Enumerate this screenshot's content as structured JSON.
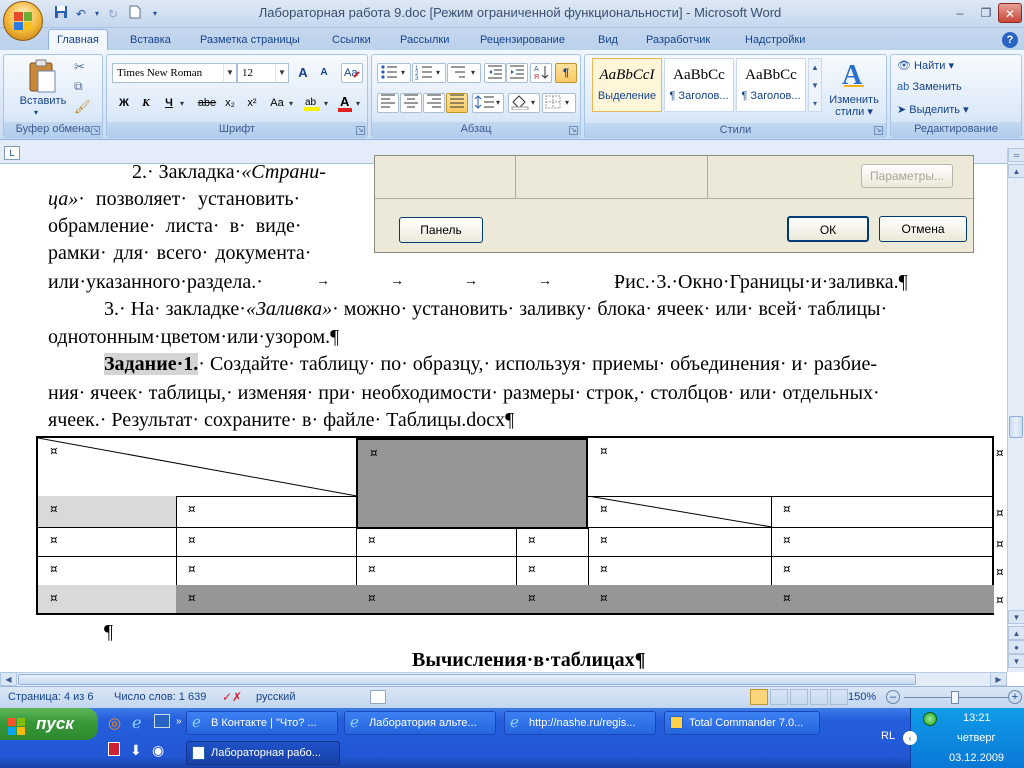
{
  "window": {
    "title": "Лабораторная работа 9.doc [Режим ограниченной функциональности] - Microsoft Word",
    "minimize": "–",
    "maximize": "❐",
    "close": "✕"
  },
  "qat": [
    "save-icon",
    "undo-icon",
    "redo-icon",
    "new-doc-icon"
  ],
  "tabs": [
    {
      "label": "Главная",
      "active": true
    },
    {
      "label": "Вставка"
    },
    {
      "label": "Разметка страницы"
    },
    {
      "label": "Ссылки"
    },
    {
      "label": "Рассылки"
    },
    {
      "label": "Рецензирование"
    },
    {
      "label": "Вид"
    },
    {
      "label": "Разработчик"
    },
    {
      "label": "Надстройки"
    }
  ],
  "ribbon": {
    "clipboard": {
      "label": "Буфер обмена",
      "paste": "Вставить"
    },
    "font": {
      "label": "Шрифт",
      "font_name": "Times New Roman",
      "font_size": "12",
      "grow": "A",
      "shrink": "A",
      "bold": "Ж",
      "italic": "К",
      "underline": "Ч",
      "strike": "abe",
      "subscript": "x₂",
      "superscript": "x²",
      "case": "Aa"
    },
    "paragraph": {
      "label": "Абзац",
      "show_marks": "¶"
    },
    "styles": {
      "label": "Стили",
      "items": [
        {
          "sample": "AaBbCcI",
          "name": "Выделение"
        },
        {
          "sample": "AaBbCc",
          "name": "¶ Заголов..."
        },
        {
          "sample": "AaBbCc",
          "name": "¶ Заголов..."
        }
      ],
      "change_styles_1": "Изменить",
      "change_styles_2": "стили"
    },
    "editing": {
      "label": "Редактирование",
      "find": "Найти",
      "replace": "Заменить",
      "select": "Выделить"
    }
  },
  "dialog": {
    "params_button": "Параметры...",
    "panel_button": "Панель",
    "ok_button": "ОК",
    "cancel_button": "Отмена"
  },
  "document": {
    "p2_line1a": "2.· Закладка·",
    "p2_line1b": "«Страни-",
    "p2_line2a": "ца»",
    "p2_line2b": "· позволяет· установить·",
    "p2_line3": "обрамление· листа· в· виде·",
    "p2_line4": "рамки· для· всего· документа·",
    "p2_line5": "или·указанного·раздела.·",
    "caption": "Рис.·3.·Окно·Границы·и·заливка.¶",
    "p3_line1a": "3.· На· закладке·",
    "p3_line1b": "«Заливка»",
    "p3_line1c": "· можно· установить· заливку· блока· ячеек· или· всей· таблицы·",
    "p3_line2": "однотонным·цветом·или·узором.¶",
    "task_label": "Задание·1.",
    "task_line1": "· Создайте· таблицу· по· образцу,· используя· приемы· объединения· и· разбие-",
    "task_line2": "ния· ячеек· таблицы,· изменяя· при· необходимости· размеры· строк,· столбцов· или· отдельных·",
    "task_line3": "ячеек.· Результат· сохраните· в· файле· Таблицы.docx¶",
    "empty_para": "¶",
    "heading": "Вычисления·в·таблицах¶",
    "cell_mark": "¤"
  },
  "statusbar": {
    "page": "Страница: 4 из 6",
    "words": "Число слов: 1 639",
    "language": "русский",
    "zoom": "150%",
    "zoom_out": "–",
    "zoom_in": "+"
  },
  "taskbar": {
    "start": "пуск",
    "windows": [
      {
        "label": "В Контакте | \"Что? ..."
      },
      {
        "label": "Лаборатория альте..."
      },
      {
        "label": "http://nashe.ru/regis..."
      },
      {
        "label": "Total Commander 7.0..."
      },
      {
        "label": "Лабораторная рабо...",
        "active": true
      }
    ],
    "tray": {
      "lang": "RL",
      "time": "13:21",
      "day": "четверг",
      "date": "03.12.2009"
    }
  }
}
